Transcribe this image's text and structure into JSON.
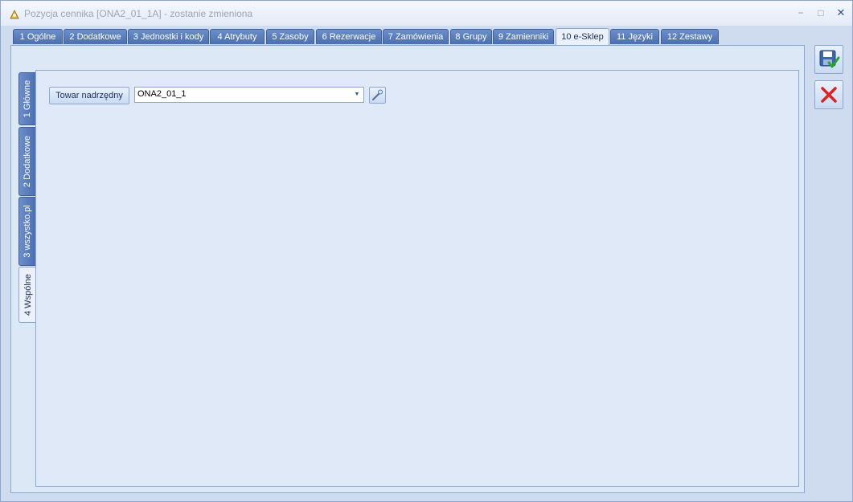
{
  "window": {
    "title": "Pozycja cennika [ONA2_01_1A] - zostanie zmieniona",
    "controls": {
      "minimize": "−",
      "maximize": "□",
      "close": "✕"
    }
  },
  "tabs": [
    {
      "label": "1 Ogólne",
      "active": false
    },
    {
      "label": "2 Dodatkowe",
      "active": false
    },
    {
      "label": "3 Jednostki i kody",
      "active": false
    },
    {
      "label": "4 Atrybuty",
      "active": false
    },
    {
      "label": "5 Zasoby",
      "active": false
    },
    {
      "label": "6 Rezerwacje",
      "active": false
    },
    {
      "label": "7 Zamówienia",
      "active": false
    },
    {
      "label": "8 Grupy",
      "active": false
    },
    {
      "label": "9 Zamienniki",
      "active": false
    },
    {
      "label": "10 e-Sklep",
      "active": true
    },
    {
      "label": "11 Języki",
      "active": false
    },
    {
      "label": "12 Zestawy",
      "active": false
    }
  ],
  "vertical_tabs": [
    {
      "label": "1 Główne",
      "active": false
    },
    {
      "label": "2 Dodatkowe",
      "active": false
    },
    {
      "label": "3 wszystko.pl",
      "active": false
    },
    {
      "label": "4 Wspólne",
      "active": true
    }
  ],
  "form": {
    "parent_item_label": "Towar nadrzędny",
    "parent_item_value": "ONA2_01_1"
  },
  "icons": {
    "app": "app-icon",
    "picker": "magic-wand-icon",
    "save": "save-icon",
    "cancel": "cancel-icon"
  },
  "colors": {
    "tab_blue": "#4a6fb2",
    "cancel_red": "#e02020",
    "save_green": "#2aa52a"
  }
}
